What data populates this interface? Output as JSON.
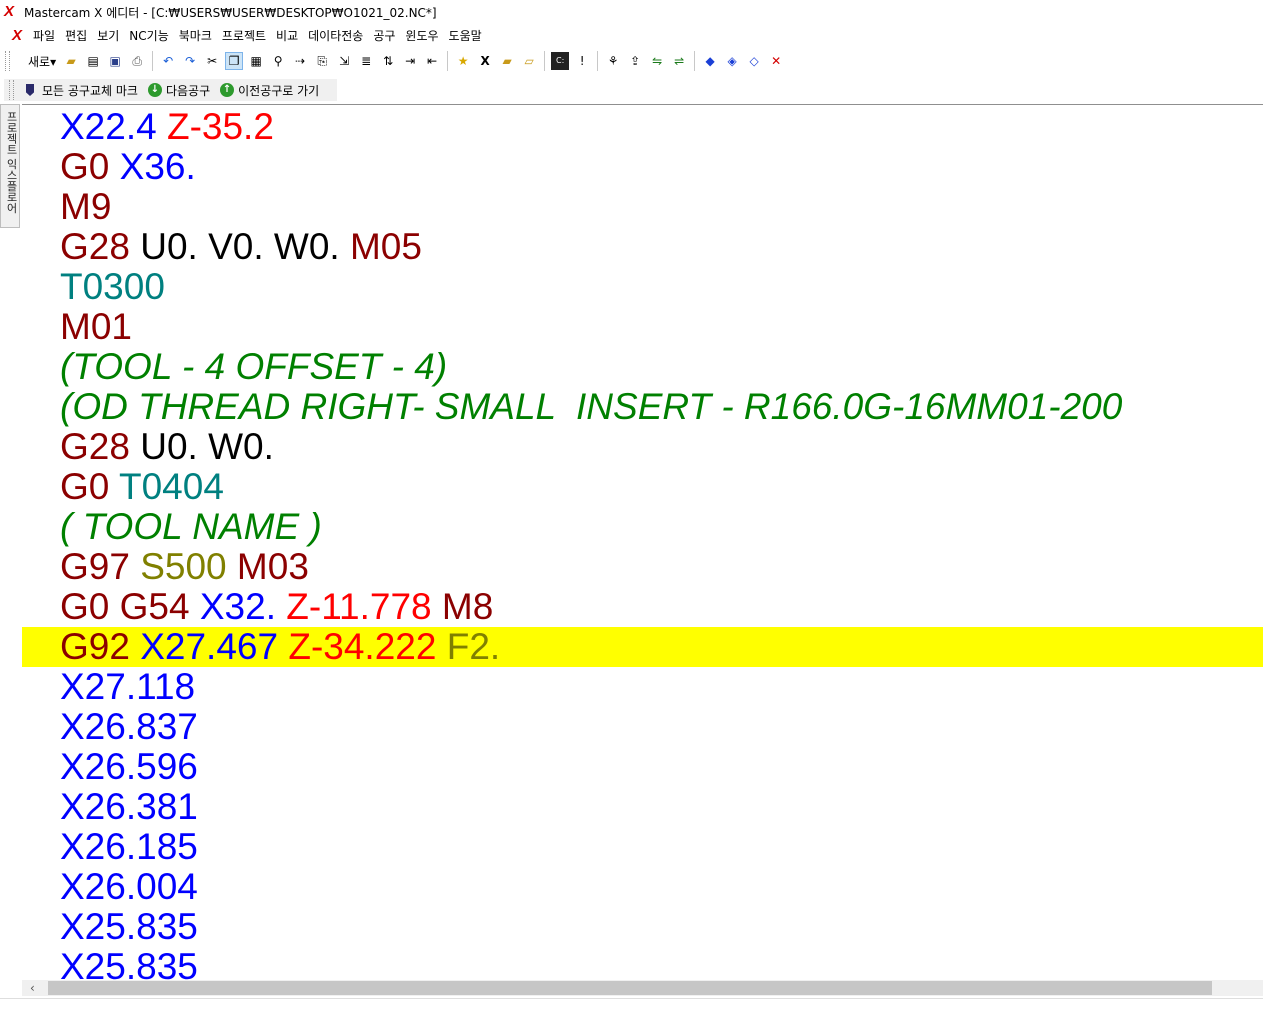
{
  "window": {
    "title": "Mastercam X 에디터 - [C:₩USERS₩USER₩DESKTOP₩O1021_02.NC*]"
  },
  "menu": {
    "items": [
      "파일",
      "편집",
      "보기",
      "NC기능",
      "북마크",
      "프로젝트",
      "비교",
      "데이타전송",
      "공구",
      "윈도우",
      "도움말"
    ]
  },
  "toolbar": {
    "new_label": "새로"
  },
  "tool_nav": {
    "all_tool_change_mark": "모든 공구교체 마크",
    "next_tool": "다음공구",
    "prev_tool": "이전공구로 가기"
  },
  "side_panel": {
    "label": "프로젝트 익스플로어"
  },
  "colors": {
    "g_code": "#8b0000",
    "m_code": "#8b0000",
    "x_axis": "#0000ff",
    "z_axis": "#ff0000",
    "uvw": "#000000",
    "tool": "#008080",
    "spindle_feed": "#808000",
    "comment": "#008000",
    "highlight": "#ffff00"
  },
  "code_lines": [
    {
      "tokens": [
        {
          "text": "X22.4",
          "kind": "x_axis"
        },
        {
          "text": "Z-35.2",
          "kind": "z_axis"
        }
      ]
    },
    {
      "tokens": [
        {
          "text": "G0",
          "kind": "g_code"
        },
        {
          "text": "X36.",
          "kind": "x_axis"
        }
      ]
    },
    {
      "tokens": [
        {
          "text": "M9",
          "kind": "m_code"
        }
      ]
    },
    {
      "tokens": [
        {
          "text": "G28",
          "kind": "g_code"
        },
        {
          "text": "U0. V0. W0.",
          "kind": "uvw"
        },
        {
          "text": "M05",
          "kind": "m_code"
        }
      ]
    },
    {
      "tokens": [
        {
          "text": "T0300",
          "kind": "tool"
        }
      ]
    },
    {
      "tokens": [
        {
          "text": "M01",
          "kind": "m_code"
        }
      ]
    },
    {
      "comment": true,
      "tokens": [
        {
          "text": "(TOOL - 4 OFFSET - 4)",
          "kind": "comment"
        }
      ]
    },
    {
      "comment": true,
      "tokens": [
        {
          "text": "(OD THREAD RIGHT- SMALL  INSERT - R166.0G-16MM01-200",
          "kind": "comment"
        }
      ]
    },
    {
      "tokens": [
        {
          "text": "G28",
          "kind": "g_code"
        },
        {
          "text": "U0. W0.",
          "kind": "uvw"
        }
      ]
    },
    {
      "tokens": [
        {
          "text": "G0",
          "kind": "g_code"
        },
        {
          "text": "T0404",
          "kind": "tool"
        }
      ]
    },
    {
      "comment": true,
      "tokens": [
        {
          "text": "( TOOL NAME )",
          "kind": "comment"
        }
      ]
    },
    {
      "tokens": [
        {
          "text": "G97",
          "kind": "g_code"
        },
        {
          "text": "S500",
          "kind": "spindle_feed"
        },
        {
          "text": "M03",
          "kind": "m_code"
        }
      ]
    },
    {
      "tokens": [
        {
          "text": "G0 G54",
          "kind": "g_code"
        },
        {
          "text": "X32.",
          "kind": "x_axis"
        },
        {
          "text": "Z-11.778",
          "kind": "z_axis"
        },
        {
          "text": "M8",
          "kind": "m_code"
        }
      ]
    },
    {
      "current": true,
      "tokens": [
        {
          "text": "G92",
          "kind": "g_code"
        },
        {
          "text": "X27.467",
          "kind": "x_axis"
        },
        {
          "text": "Z-34.222",
          "kind": "z_axis"
        },
        {
          "text": "F2.",
          "kind": "spindle_feed"
        }
      ]
    },
    {
      "tokens": [
        {
          "text": "X27.118",
          "kind": "x_axis"
        }
      ]
    },
    {
      "tokens": [
        {
          "text": "X26.837",
          "kind": "x_axis"
        }
      ]
    },
    {
      "tokens": [
        {
          "text": "X26.596",
          "kind": "x_axis"
        }
      ]
    },
    {
      "tokens": [
        {
          "text": "X26.381",
          "kind": "x_axis"
        }
      ]
    },
    {
      "tokens": [
        {
          "text": "X26.185",
          "kind": "x_axis"
        }
      ]
    },
    {
      "tokens": [
        {
          "text": "X26.004",
          "kind": "x_axis"
        }
      ]
    },
    {
      "tokens": [
        {
          "text": "X25.835",
          "kind": "x_axis"
        }
      ]
    },
    {
      "tokens": [
        {
          "text": "X25.835",
          "kind": "x_axis"
        }
      ]
    }
  ]
}
